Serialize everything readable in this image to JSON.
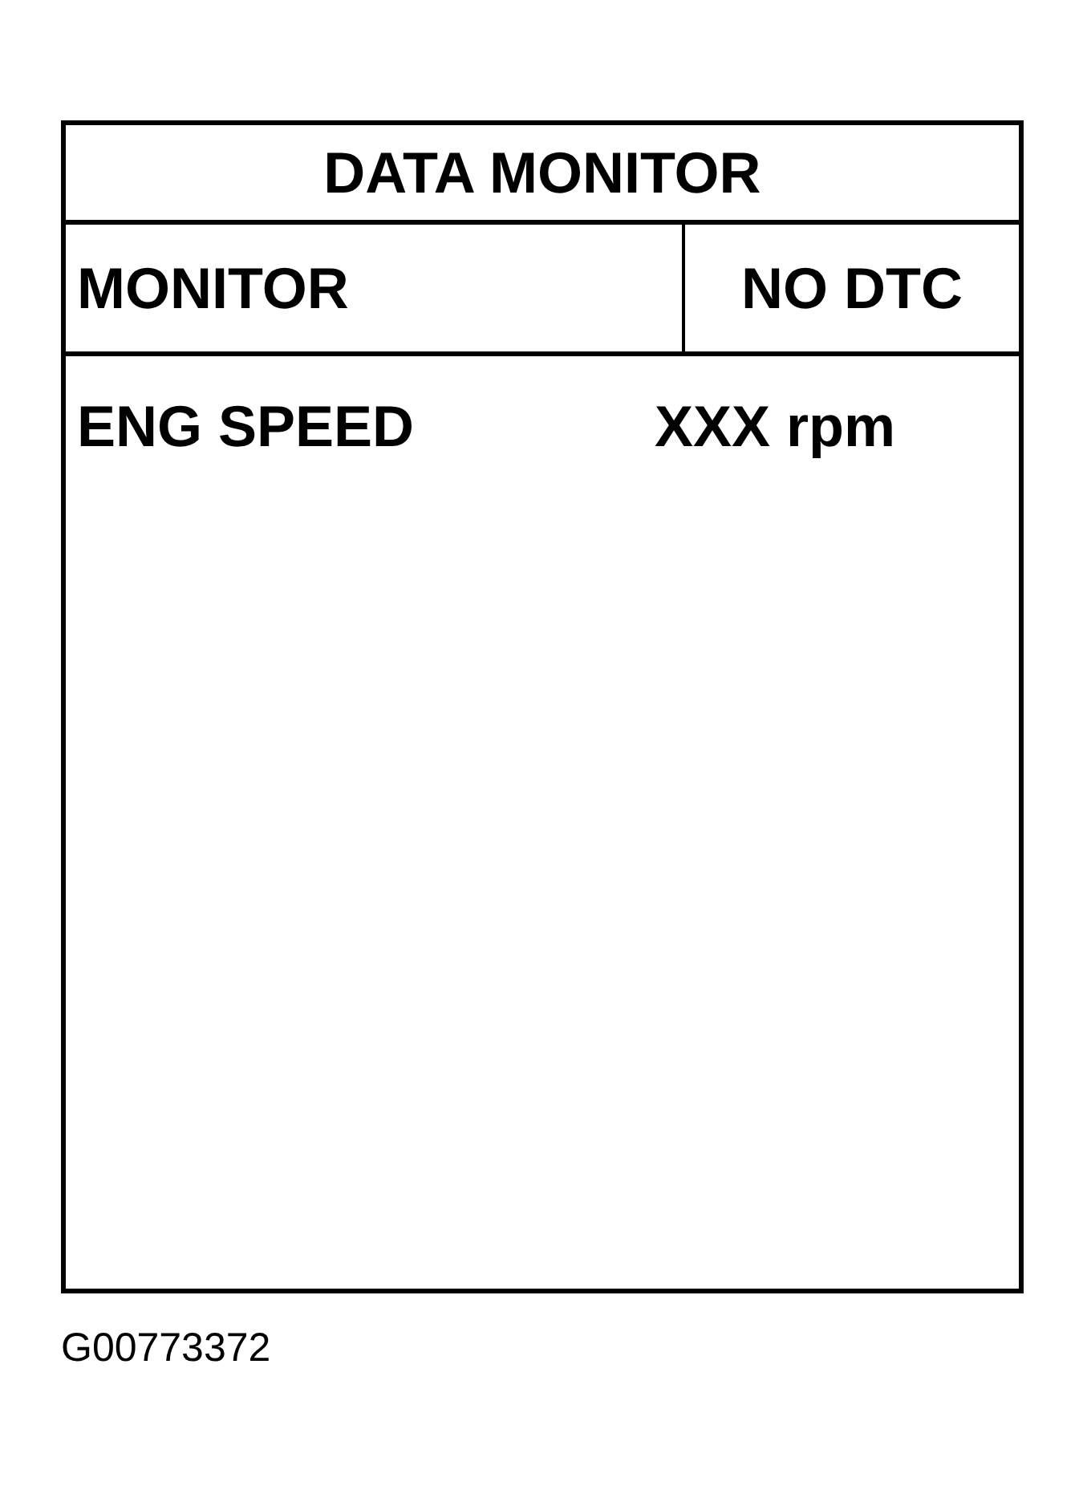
{
  "screen": {
    "title": "DATA MONITOR",
    "mode": "MONITOR",
    "status": "NO DTC",
    "rows": [
      {
        "label": "ENG SPEED",
        "value": "XXX rpm"
      }
    ]
  },
  "figure_id": "G00773372"
}
